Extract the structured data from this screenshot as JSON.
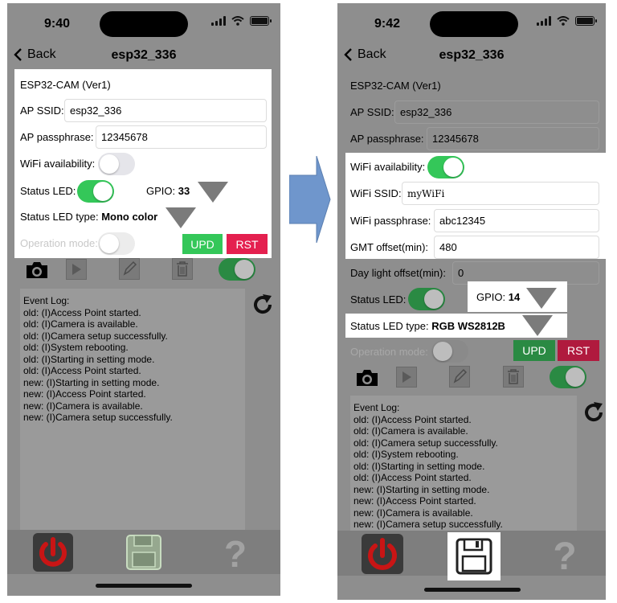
{
  "left": {
    "time": "9:40",
    "back_label": "Back",
    "title": "esp32_336",
    "device_name": "ESP32-CAM (Ver1)",
    "ap_ssid_label": "AP SSID:",
    "ap_ssid_value": "esp32_336",
    "ap_pass_label": "AP passphrase:",
    "ap_pass_value": "12345678",
    "wifi_avail_label": "WiFi availability:",
    "status_led_label": "Status LED:",
    "gpio_label": "GPIO:",
    "gpio_value": "33",
    "led_type_label": "Status LED type:",
    "led_type_value": "Mono color",
    "operation_mode_label": "Operation mode:",
    "upd_label": "UPD",
    "rst_label": "RST",
    "log_lines": [
      "Event Log:",
      "old: (I)Access Point started.",
      "old: (I)Camera is available.",
      "old: (I)Camera setup successfully.",
      "old: (I)System rebooting.",
      "old: (I)Starting in setting mode.",
      "old: (I)Access Point started.",
      "new: (I)Starting in setting mode.",
      "new: (I)Access Point started.",
      "new: (I)Camera is available.",
      "new: (I)Camera setup successfully."
    ]
  },
  "right": {
    "time": "9:42",
    "back_label": "Back",
    "title": "esp32_336",
    "device_name": "ESP32-CAM (Ver1)",
    "ap_ssid_label": "AP SSID:",
    "ap_ssid_value": "esp32_336",
    "ap_pass_label": "AP passphrase:",
    "ap_pass_value": "12345678",
    "wifi_avail_label": "WiFi availability:",
    "wifi_ssid_label": "WiFi SSID:",
    "wifi_ssid_value": "myWiFi",
    "wifi_pass_label": "WiFi passphrase:",
    "wifi_pass_value": "abc12345",
    "gmt_label": "GMT offset(min):",
    "gmt_value": "480",
    "daylight_label": "Day light offset(min):",
    "daylight_value": "0",
    "status_led_label": "Status LED:",
    "gpio_label": "GPIO:",
    "gpio_value": "14",
    "led_type_label": "Status LED type:",
    "led_type_value": "RGB WS2812B",
    "operation_mode_label": "Operation mode:",
    "upd_label": "UPD",
    "rst_label": "RST",
    "log_lines": [
      "Event Log:",
      "old: (I)Access Point started.",
      "old: (I)Camera is available.",
      "old: (I)Camera setup successfully.",
      "old: (I)System rebooting.",
      "old: (I)Starting in setting mode.",
      "old: (I)Access Point started.",
      "new: (I)Starting in setting mode.",
      "new: (I)Access Point started.",
      "new: (I)Camera is available.",
      "new: (I)Camera setup successfully."
    ]
  },
  "colors": {
    "toggle_on": "#34c759",
    "upd_green": "#34c759",
    "rst_red": "#e4204f",
    "arrow_blue": "#6f96cc",
    "power_red": "#c91515"
  },
  "icons": [
    "chevron-left-icon",
    "wifi-icon",
    "signal-icon",
    "battery-icon",
    "camera-icon",
    "play-icon",
    "pencil-icon",
    "trash-icon",
    "refresh-icon",
    "power-icon",
    "save-icon",
    "help-icon",
    "dropdown-triangle-icon",
    "right-arrow-icon"
  ]
}
